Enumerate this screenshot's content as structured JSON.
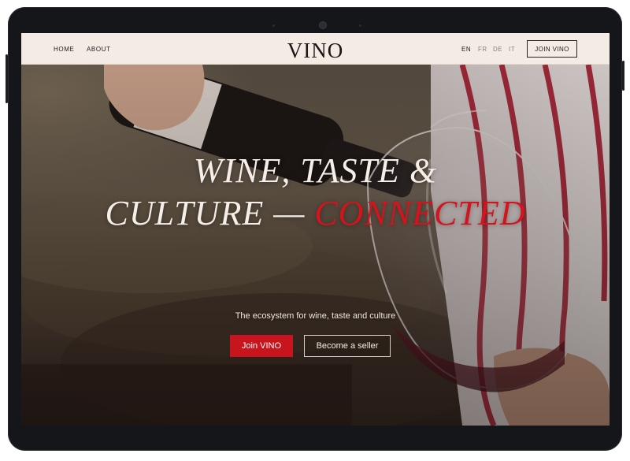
{
  "nav": {
    "links": [
      "HOME",
      "ABOUT"
    ],
    "logo": "VINO",
    "languages": [
      "EN",
      "FR",
      "DE",
      "IT"
    ],
    "active_language": "EN",
    "join_label": "JOIN VINO"
  },
  "hero": {
    "headline_line1": "WINE, TASTE &",
    "headline_line2_main": "CULTURE — ",
    "headline_line2_accent": "CONNECTED",
    "subtitle": "The ecosystem for wine, taste and culture",
    "primary_cta": "Join VINO",
    "secondary_cta": "Become a seller"
  },
  "colors": {
    "accent": "#d4131d",
    "button_red": "#c8141c",
    "nav_background": "#f4ebe5",
    "device_frame": "#15161a"
  }
}
